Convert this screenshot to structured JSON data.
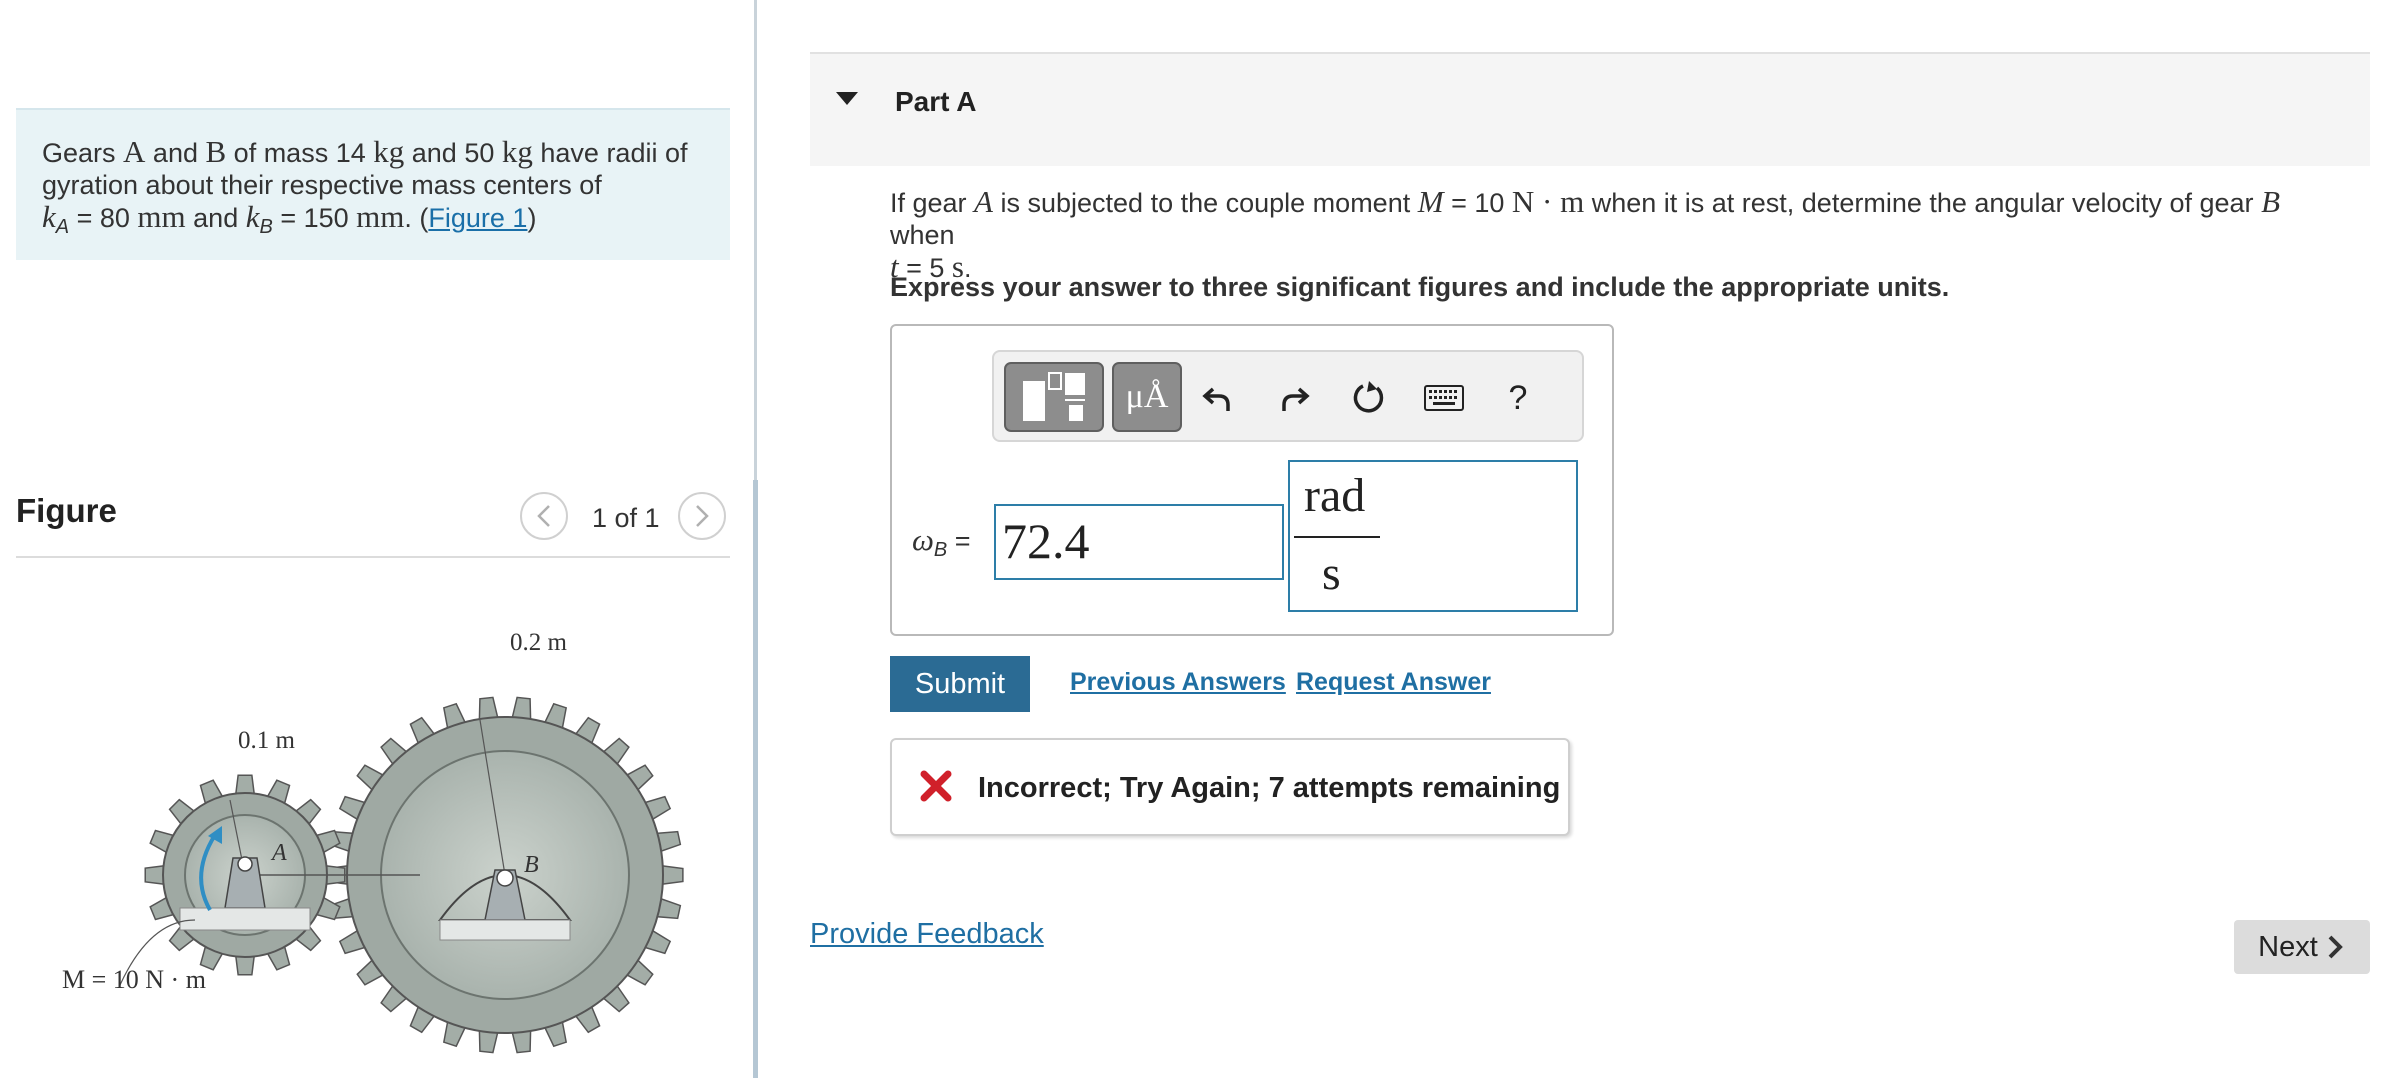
{
  "problem": {
    "text_intro": "Gears ",
    "gear_a": "A",
    "text_and": " and ",
    "gear_b": "B",
    "text_mass_of": " of mass ",
    "mass_a": "14",
    "unit_kg": "kg",
    "text_and2": " and ",
    "mass_b": "50",
    "text_rest": " have radii of gyration about their respective mass centers of",
    "k_a_symbol": "k",
    "k_a_sub": "A",
    "k_a_eq": " = 80 ",
    "unit_mm": "mm",
    "text_and3": " and ",
    "k_b_symbol": "k",
    "k_b_sub": "B",
    "k_b_eq": " = 150 ",
    "period": ". (",
    "figure_link": "Figure 1",
    "close_paren": ")"
  },
  "figure": {
    "title": "Figure",
    "counter": "1 of 1",
    "prev_icon": "chevron-left-icon",
    "next_icon": "chevron-right-icon",
    "labels": {
      "radius_b": "0.2 m",
      "radius_a": "0.1 m",
      "label_a": "A",
      "label_b": "B",
      "moment": "M = 10 N · m"
    }
  },
  "part": {
    "title": "Part A",
    "question_1": "If gear ",
    "question_gear_a": "A",
    "question_2": " is subjected to the couple moment ",
    "question_m": "M",
    "question_3": " = 10 ",
    "question_unit": "N · m",
    "question_4": " when it is at rest, determine the angular velocity of gear ",
    "question_gear_b": "B",
    "question_5": " when",
    "question_t": "t",
    "question_6": " = 5 ",
    "question_s": "s",
    "question_7": ".",
    "instruction": "Express your answer to three significant figures and include the appropriate units."
  },
  "answer": {
    "toolbar_symbols": "μÅ",
    "help": "?",
    "omega_symbol": "ω",
    "omega_sub": "B",
    "omega_eq": " =",
    "value": "72.4",
    "unit_numerator": "rad",
    "unit_denominator": "s"
  },
  "actions": {
    "submit": "Submit",
    "previous_answers": "Previous Answers",
    "request_answer": "Request Answer"
  },
  "feedback": {
    "message": "Incorrect; Try Again; 7 attempts remaining",
    "status_color": "#d0202a"
  },
  "footer": {
    "provide_feedback": "Provide Feedback",
    "next": "Next"
  },
  "colors": {
    "accent_blue": "#2b6b94",
    "link_blue": "#1f6fa3",
    "problem_bg": "#e8f3f6"
  }
}
